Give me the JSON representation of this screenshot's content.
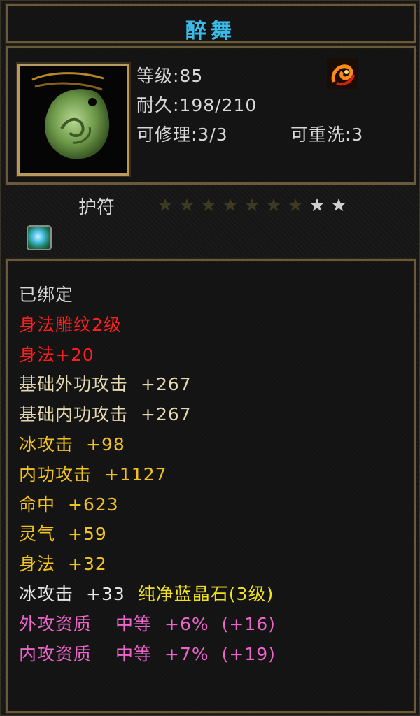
{
  "item": {
    "name": "醉舞",
    "level": "等级:85",
    "durability": "耐久:198/210",
    "repairable": "可修理:3/3",
    "rewashable": "可重洗:3",
    "type": "护符",
    "stars": {
      "filled": 7,
      "total": 9
    },
    "element_icon": "fire-swirl-icon",
    "gem_icon": "blue-crystal-gem-icon"
  },
  "attributes": [
    {
      "text": "已绑定",
      "color": "#d8d8d8"
    },
    {
      "text": "身法雕纹2级",
      "color": "#ff1e1e"
    },
    {
      "text": "身法+20",
      "color": "#ff1e1e"
    },
    {
      "label": "基础外功攻击",
      "value": "+267",
      "color": "#e4d8b0"
    },
    {
      "label": "基础内功攻击",
      "value": "+267",
      "color": "#e4d8b0"
    },
    {
      "label": "冰攻击",
      "value": "+98",
      "color": "#f2c21e"
    },
    {
      "label": "内功攻击",
      "value": "+1127",
      "color": "#f2c21e"
    },
    {
      "label": "命中",
      "value": "+623",
      "color": "#f2c21e"
    },
    {
      "label": "灵气",
      "value": "+59",
      "color": "#f2c21e"
    },
    {
      "label": "身法",
      "value": "+32",
      "color": "#f2c21e"
    },
    {
      "label": "冰攻击",
      "value": "+33",
      "gem": "纯净蓝晶石(3级)",
      "color": "#e6e6e6",
      "gem_color": "#f2e21e"
    },
    {
      "label": "外攻资质",
      "grade": "中等",
      "value": "+6%",
      "bonus": "(+16)",
      "color": "#ee66cc"
    },
    {
      "label": "内攻资质",
      "grade": "中等",
      "value": "+7%",
      "bonus": "(+19)",
      "color": "#ee66cc"
    }
  ]
}
